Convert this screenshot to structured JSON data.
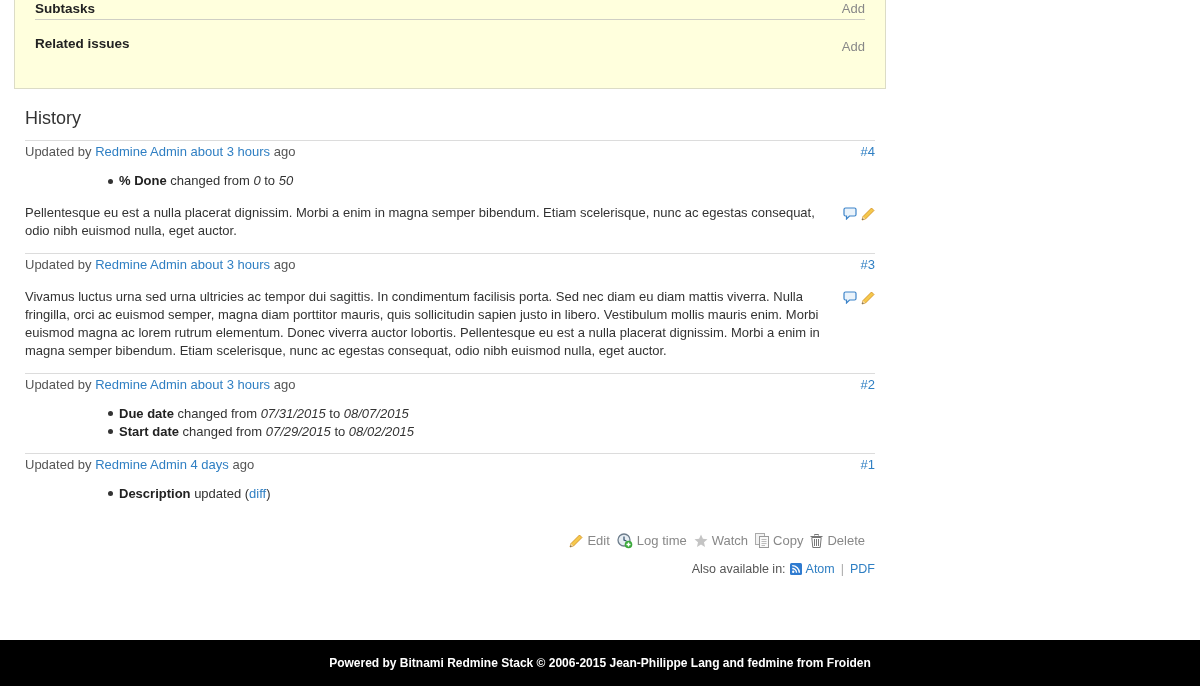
{
  "issue_panel": {
    "sections": [
      {
        "title": "Subtasks",
        "action": "Add"
      },
      {
        "title": "Related issues",
        "action": "Add"
      }
    ]
  },
  "history": {
    "title": "History",
    "journals": [
      {
        "prefix": "Updated by",
        "author": "Redmine Admin",
        "time": "about 3 hours",
        "suffix": "ago",
        "number": "#4",
        "details": [
          {
            "kind": "change",
            "text": "**% Done** changed from *0* to *50*"
          }
        ],
        "note": "Pellentesque eu est a nulla placerat dignissim. Morbi a enim in magna semper bibendum. Etiam scelerisque, nunc ac egestas consequat, odio nibh euismod nulla, eget auctor."
      },
      {
        "prefix": "Updated by",
        "author": "Redmine Admin",
        "time": "about 3 hours",
        "suffix": "ago",
        "number": "#3",
        "note": "Vivamus luctus urna sed urna ultricies ac tempor dui sagittis. In condimentum facilisis porta. Sed nec diam eu diam mattis viverra. Nulla fringilla, orci ac euismod semper, magna diam porttitor mauris, quis sollicitudin sapien justo in libero. Vestibulum mollis mauris enim. Morbi euismod magna ac lorem rutrum elementum. Donec viverra auctor lobortis. Pellentesque eu est a nulla placerat dignissim. Morbi a enim in magna semper bibendum. Etiam scelerisque, nunc ac egestas consequat, odio nibh euismod nulla, eget auctor."
      },
      {
        "prefix": "Updated by",
        "author": "Redmine Admin",
        "time": "about 3 hours",
        "suffix": "ago",
        "number": "#2",
        "details": [
          {
            "kind": "change",
            "text": "**Due date** changed from *07/31/2015* to *08/07/2015*"
          },
          {
            "kind": "change",
            "text": "**Start date** changed from *07/29/2015* to *08/02/2015*"
          }
        ]
      },
      {
        "prefix": "Updated by",
        "author": "Redmine Admin",
        "time": "4 days",
        "suffix": "ago",
        "number": "#1",
        "details": [
          {
            "kind": "diff",
            "text": "**Description** updated (",
            "link": "diff",
            "after": ")"
          }
        ]
      }
    ]
  },
  "actions": [
    {
      "kind": "edit",
      "label": "Edit"
    },
    {
      "kind": "log_time",
      "label": "Log time"
    },
    {
      "kind": "watch",
      "label": "Watch"
    },
    {
      "kind": "copy",
      "label": "Copy"
    },
    {
      "kind": "delete",
      "label": "Delete"
    }
  ],
  "other_formats": {
    "label": "Also available in:",
    "links": [
      {
        "kind": "atom",
        "label": "Atom"
      },
      {
        "kind": "pdf",
        "label": "PDF"
      }
    ],
    "separator": "|"
  },
  "footer": {
    "text": "Powered by Bitnami Redmine Stack © 2006-2015 Jean-Philippe Lang and fedmine from Froiden"
  }
}
